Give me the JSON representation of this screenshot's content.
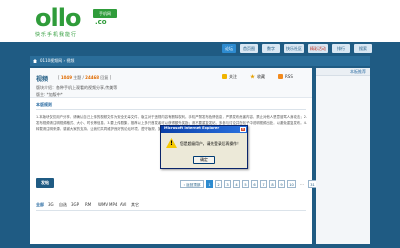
{
  "site": {
    "logo_text": "ollo",
    "logo_badge": "手机网",
    "logo_domain": ".co",
    "slogan": "快乐手机我能行"
  },
  "nav": {
    "tabs": [
      "论坛",
      "首页图",
      "数字",
      "快乐社区",
      "精彩活动",
      "排行",
      "搜索"
    ]
  },
  "breadcrumb": {
    "text": "0110视频网 › 视频"
  },
  "forum": {
    "name": "视频",
    "stats_prefix": "[",
    "topics": "1049",
    "topics_label": "主题 /",
    "posts": "24468",
    "posts_label": "回复 ]",
    "description": "版块介绍：各种手机上观看的视频分享,传美等",
    "moderator": "版主: *加版中*",
    "actions": {
      "focus": "关注",
      "favorite": "收藏",
      "rss": "RSS"
    }
  },
  "sidebar": {
    "title": "本板推荐"
  },
  "rules": {
    "title": "本版规则",
    "body": "1.本版块仅仅用户分享，请确认自己上传的视频文件为安全无毒文件，版主对于违规内容有删除权利。手机严禁发布色情信息，严禁发布危害内容，禁止对他人恶意谩骂人身攻击；2.发布视频请注明视频格式、大小、时长等信息，3.要上传剧集，推荐以上多只首发者可以获得额外奖励；请不要重复发帖，多参与讨论并在帖子中说明视频出处，以避免重复发布。4.转载请注明来源，感谢大家的支持，让我们共同维护良好的论坛环境，遵守版规，如有违规行为请及时举报，谢谢合作。"
  },
  "toolbar": {
    "post_label": "发帖"
  },
  "pager": {
    "prev": "‹ 返回顶部",
    "pages": [
      "1",
      "2",
      "3",
      "4",
      "5",
      "6",
      "7",
      "8",
      "9",
      "10"
    ],
    "ellipsis": "...",
    "last": "31",
    "next": "下一页 ›"
  },
  "filters": [
    "全部",
    "3G",
    "自选",
    "3GP",
    "RM",
    "WMV",
    "MP4",
    "AVI",
    "其它"
  ],
  "dialog": {
    "title": "Microsoft Internet Explorer",
    "close_glyph": "×",
    "warn_glyph": "!",
    "message": "您是超级用户，请先登录后再操作！",
    "ok_label": "确定"
  }
}
